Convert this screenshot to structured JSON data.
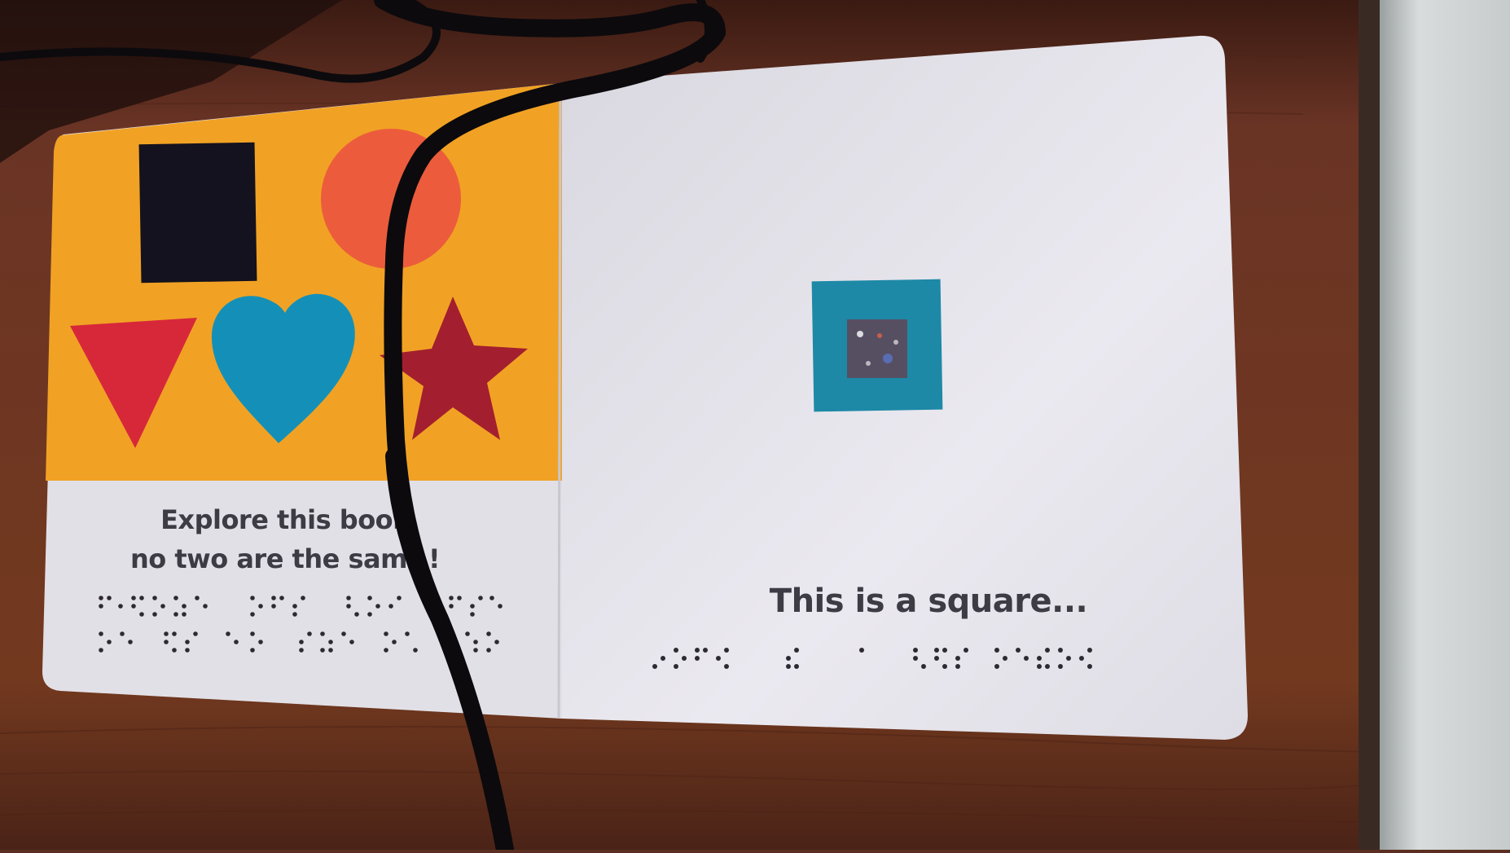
{
  "left_page": {
    "caption_line_1": "Explore this book",
    "caption_line_2": "no two are the sam",
    "caption_line_2_end": "!"
  },
  "right_page": {
    "caption": "This is a square..."
  },
  "colors": {
    "table": "#6e3726",
    "page_white": "#e4e2e9",
    "left_panel": "#f1a224",
    "black_square": "#14121e",
    "orange_circle": "#ec5c3c",
    "red_triangle": "#d7283a",
    "blue_heart": "#1490b8",
    "crimson_star": "#a31f2f",
    "teal_square": "#1d89a6",
    "cord": "#0c0a0d"
  }
}
